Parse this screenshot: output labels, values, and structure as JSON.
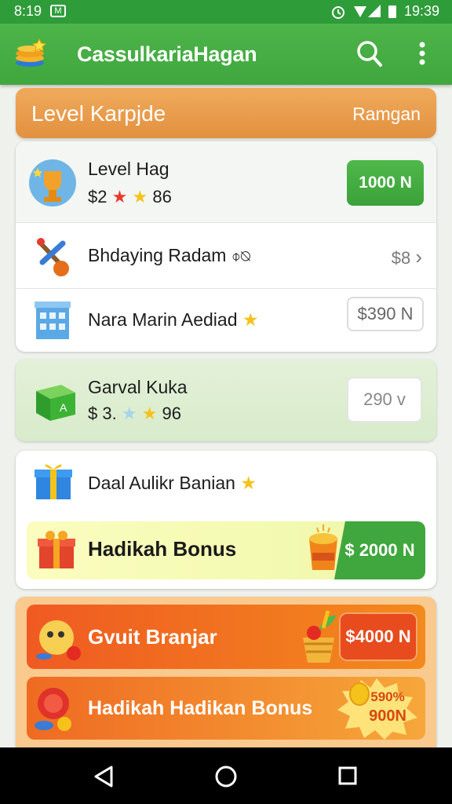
{
  "status": {
    "time_left": "8:19",
    "time_right": "19:39",
    "notif": "M"
  },
  "app": {
    "title": "CassulkariaHagan",
    "logo_icon": "coins-star-icon",
    "search_icon": "search-icon",
    "menu_icon": "more-vert-icon"
  },
  "section": {
    "title": "Level Karpjde",
    "right": "Ramgan"
  },
  "list1": {
    "item1": {
      "title": "Level Hag",
      "price_prefix": "$2",
      "rating": "86",
      "button": "1000 N"
    },
    "item2": {
      "title": "Bhdaying Radam",
      "suffix": "⌽⍉",
      "price": "$8",
      "chevron": "›"
    },
    "item3": {
      "title": "Nara Marin Aediad",
      "button": "$390 N"
    }
  },
  "green_card": {
    "title": "Garval Kuka",
    "price_prefix": "$ 3.",
    "rating": "96",
    "button": "290 v"
  },
  "bonus_card": {
    "item1": {
      "title": "Daal Aulikr Banian"
    },
    "item2": {
      "title": "Hadikah Bonus",
      "button": "$ 2000 N"
    }
  },
  "orange_card": {
    "item1": {
      "title": "Gvuit Branjar",
      "button": "$4000 N"
    },
    "item2": {
      "title": "Hadikah Hadikan Bonus",
      "badge_top": "590%",
      "badge_bottom": "900N"
    }
  },
  "colors": {
    "green": "#3fa73d",
    "orange": "#e2913f",
    "deep_orange": "#e8621e"
  }
}
